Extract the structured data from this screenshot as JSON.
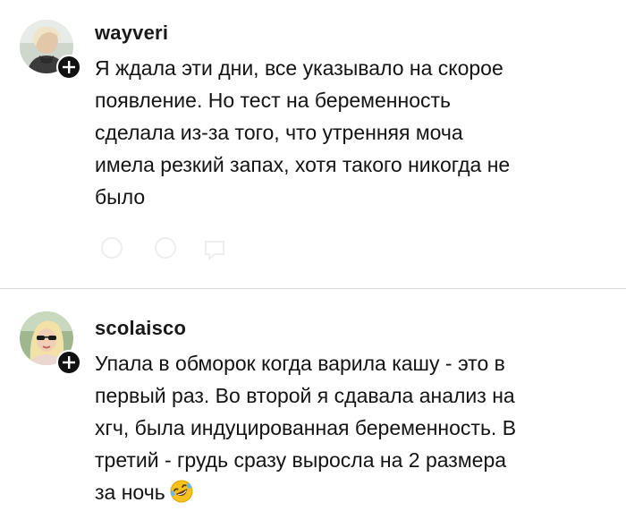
{
  "comments": [
    {
      "username": "wayveri",
      "text": "Я ждала эти дни, все указывало на скорое\nпоявление.  Но тест на беременность\nсделала из-за того, что утренняя моча\nимела резкий запах, хотя такого никогда не\nбыло",
      "avatar_icon": "user-avatar-photo",
      "badge_icon": "plus-icon"
    },
    {
      "username": "scolaisco",
      "text": "Упала в обморок когда варила кашу - это в\nпервый раз. Во второй я сдавала анализ на\nхгч, была индуцированная беременность. В\nтретий - грудь сразу выросла на 2 размера\nза ночь",
      "emoji_icon": "rolling-on-floor-laughing-emoji",
      "avatar_icon": "user-avatar-photo",
      "badge_icon": "plus-icon"
    }
  ],
  "colors": {
    "background": "#ffffff",
    "text": "#141414",
    "divider": "#d9d9d9",
    "badge": "#111111"
  }
}
